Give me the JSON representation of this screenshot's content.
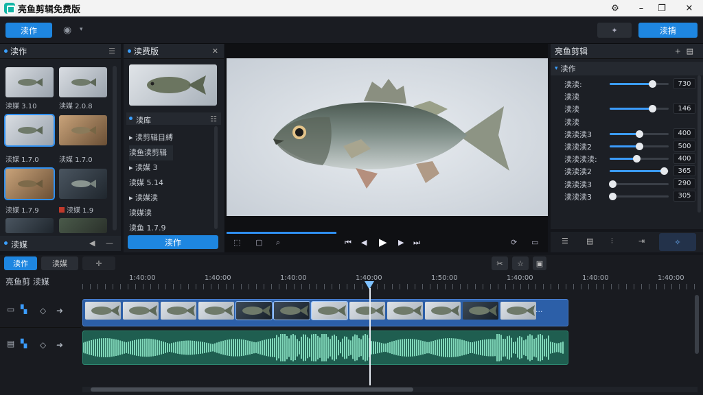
{
  "window": {
    "title": "亮鱼剪辑免费版",
    "min": "–",
    "max": "❐",
    "close": "✕"
  },
  "toolbar": {
    "left_button": "渎作",
    "right_button": "渎揹"
  },
  "media_panel": {
    "title": "渎作",
    "items": [
      {
        "label": "渎媒 3.10"
      },
      {
        "label": "渎媒 2.0.8"
      },
      {
        "label": "渎媒 1.7.0"
      },
      {
        "label": "渎媒 1.7.0"
      },
      {
        "label": "渎媒 1.7.9"
      },
      {
        "label": "渎媒 1.9"
      },
      {
        "label": ""
      },
      {
        "label": ""
      }
    ],
    "bottom_title": "渎媒"
  },
  "clip_panel": {
    "title": "渎费版",
    "sub_title": "渎库",
    "list": [
      "▸ 渎剪辑目縛",
      "渎鱼渎剪辑",
      "▸ 渎媒 3",
      "渎媒 5.14",
      "▸ 渎媒渎",
      "渎媒渎",
      "渎鱼 1.7.9"
    ],
    "button": "渎作"
  },
  "properties": {
    "panel_title": "亮鱼剪辑",
    "section": "渎作",
    "rows": [
      {
        "label": "渎渎:",
        "value": "730",
        "level": 0.72
      },
      {
        "label": "渎渎",
        "value": "",
        "level": null
      },
      {
        "label": "渎渎",
        "value": "146",
        "level": 0.72
      },
      {
        "label": "渎渎",
        "value": "",
        "level": null
      },
      {
        "label": "渎渎渎3",
        "value": "400",
        "level": 0.5
      },
      {
        "label": "渎渎渎2",
        "value": "500",
        "level": 0.5
      },
      {
        "label": "渎渎渎渎:",
        "value": "400",
        "level": 0.45
      },
      {
        "label": "渎渎渎2",
        "value": "365",
        "level": 0.92
      },
      {
        "label": "渎渎渎3",
        "value": "290",
        "level": 0.05
      },
      {
        "label": "渎渎渎3",
        "value": "305",
        "level": 0.05
      }
    ]
  },
  "timeline": {
    "tabs": [
      "渎作",
      "渎媒"
    ],
    "header_label": "亮鱼剪 渎媒",
    "ruler": [
      "1:40:00",
      "1:40:00",
      "1:40:00",
      "1:40:00",
      "1:50:00",
      "1:40:00",
      "1:40:00",
      "1:40:00"
    ]
  },
  "colors": {
    "accent": "#1e86e0",
    "audio": "#2d7f6a",
    "video": "#2c5fa8"
  }
}
